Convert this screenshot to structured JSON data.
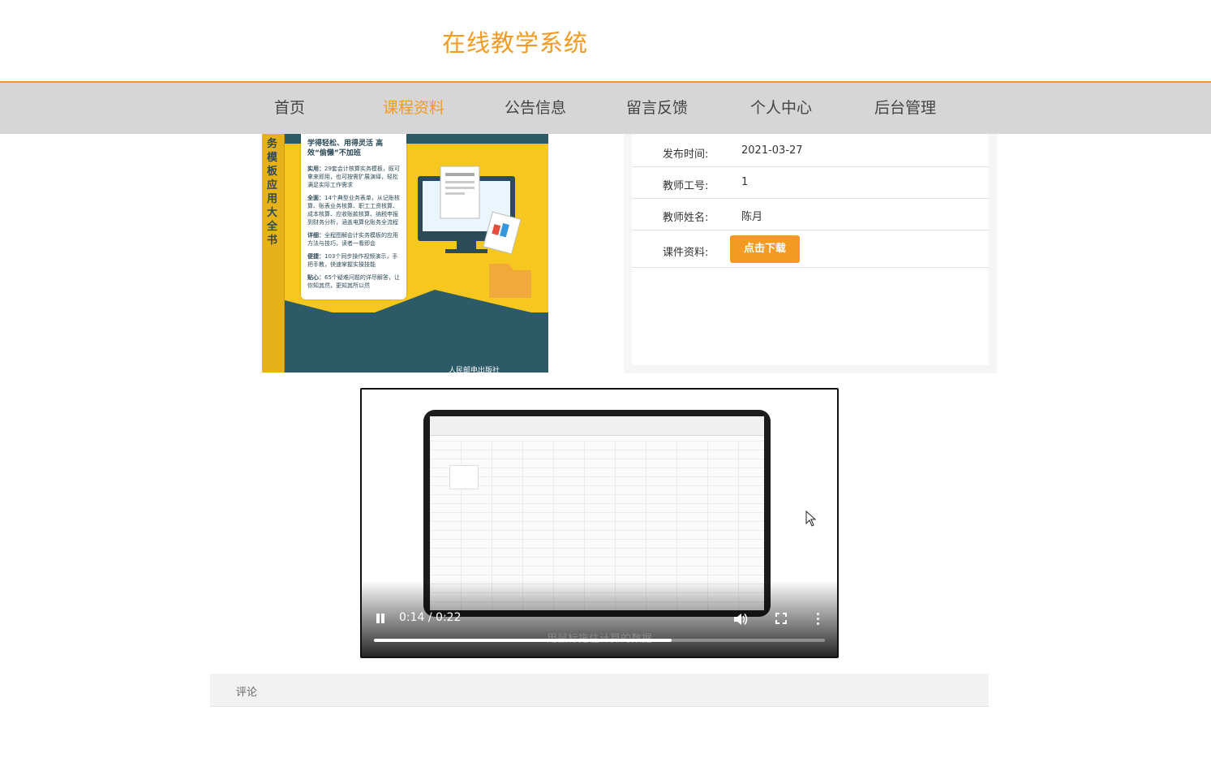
{
  "header": {
    "site_title": "在线教学系统"
  },
  "nav": {
    "items": [
      {
        "label": "首页",
        "active": false
      },
      {
        "label": "课程资料",
        "active": true
      },
      {
        "label": "公告信息",
        "active": false
      },
      {
        "label": "留言反馈",
        "active": false
      },
      {
        "label": "个人中心",
        "active": false
      },
      {
        "label": "后台管理",
        "active": false
      }
    ]
  },
  "cover": {
    "spine_text": "务模板应用大全书",
    "lead": "学得轻松、用得灵活 高效“偷懒”不加班",
    "points": [
      {
        "head": "实用：",
        "text": "29套会计核算实务模板，既可拿来即用，也可按需扩展演绎，轻松满足实际工作需求"
      },
      {
        "head": "全面：",
        "text": "14个典型业务表单，从记账核算、账表业务核算、职工工资核算、成本核算、应收账款核算、纳税申报到财务分析，涵盖电算化账务全流程"
      },
      {
        "head": "详细：",
        "text": "全程图解会计实务模板的应用方法与技巧，读者一看即会"
      },
      {
        "head": "便捷：",
        "text": "103个同步操作视频演示，手把手教，快速掌握实操技能"
      },
      {
        "head": "贴心：",
        "text": "65个疑难问题的详尽解答，让你知其然，更知其所以然"
      }
    ],
    "publisher": "人民邮电出版社"
  },
  "info": {
    "publish_time_label": "发布时间:",
    "publish_time": "2021-03-27",
    "teacher_id_label": "教师工号:",
    "teacher_id": "1",
    "teacher_name_label": "教师姓名:",
    "teacher_name": "陈月",
    "courseware_label": "课件资料:",
    "download_button": "点击下载"
  },
  "video": {
    "time": "0:14 / 0:22",
    "progress": 0.66,
    "subtitle": "用鼠标拖住计算的数据"
  },
  "comments": {
    "label": "评论"
  },
  "colors": {
    "accent": "#f39a22",
    "nav_bg": "#d6d6d6"
  }
}
